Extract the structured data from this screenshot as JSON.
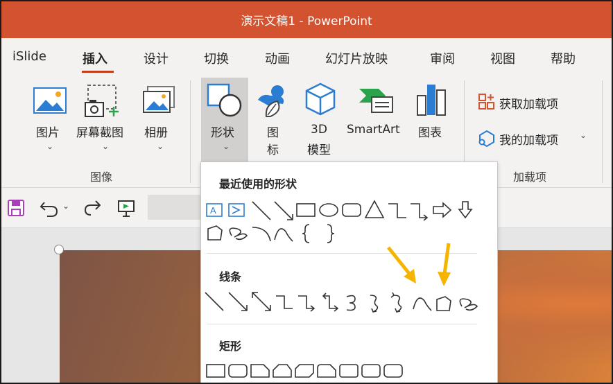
{
  "window": {
    "title": "演示文稿1  -  PowerPoint"
  },
  "tabs": [
    {
      "label": "iSlide",
      "active": false
    },
    {
      "label": "插入",
      "active": true
    },
    {
      "label": "设计",
      "active": false
    },
    {
      "label": "切换",
      "active": false
    },
    {
      "label": "动画",
      "active": false
    },
    {
      "label": "幻灯片放映",
      "active": false
    },
    {
      "label": "审阅",
      "active": false
    },
    {
      "label": "视图",
      "active": false
    },
    {
      "label": "帮助",
      "active": false
    }
  ],
  "ribbon": {
    "images_group": {
      "label": "图像",
      "picture": "图片",
      "screenshot": "屏幕截图",
      "album": "相册"
    },
    "illustrations": {
      "shapes": "形状",
      "icons_line1": "图",
      "icons_line2": "标",
      "model_line1": "3D",
      "model_line2": "模型",
      "smartart": "SmartArt",
      "chart": "图表"
    },
    "addins_group": {
      "label": "加载项",
      "get_addins": "获取加载项",
      "my_addins": "我的加载项"
    }
  },
  "shapes_menu": {
    "recent_heading": "最近使用的形状",
    "lines_heading": "线条",
    "rect_heading": "矩形"
  },
  "colors": {
    "accent": "#d35230",
    "ribbon_bg": "#f3f2f1",
    "annotation_arrow": "#f5b400",
    "icon_blue": "#2b7cd3"
  }
}
